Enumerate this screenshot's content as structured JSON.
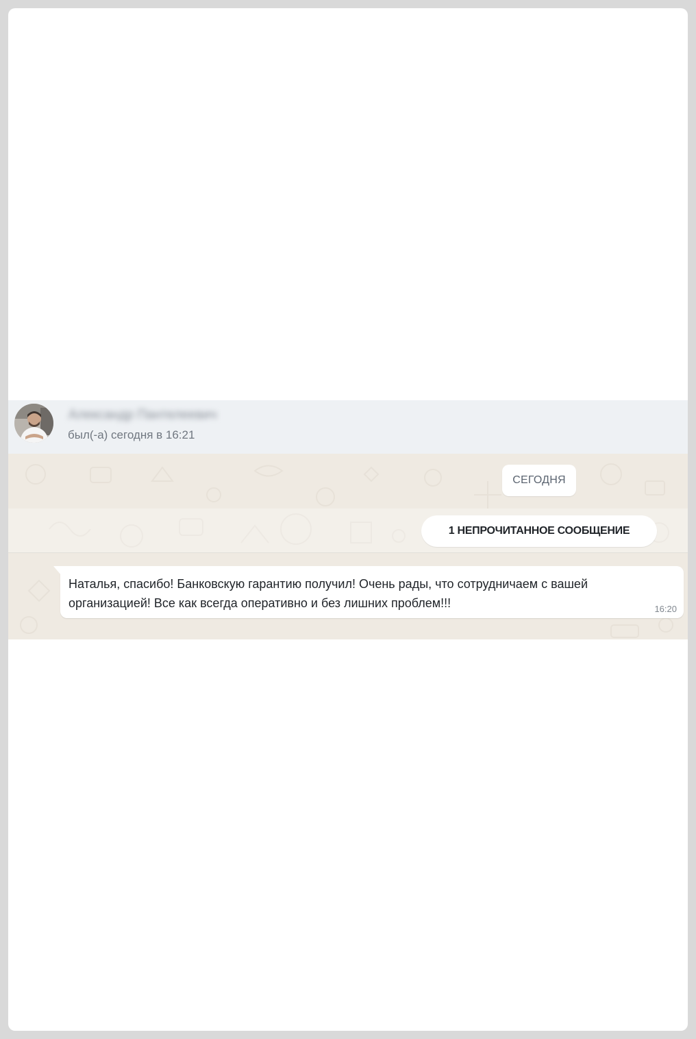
{
  "header": {
    "contact_name": "Александр Пантелеевич",
    "status": "был(-а) сегодня в 16:21"
  },
  "date_separator": {
    "label": "СЕГОДНЯ"
  },
  "unread_separator": {
    "label": "1 НЕПРОЧИТАННОЕ СООБЩЕНИЕ"
  },
  "messages": [
    {
      "text": "Наталья, спасибо! Банковскую гарантию получил! Очень рады, что сотрудничаем с вашей организацией! Все как всегда оперативно и без лишних проблем!!!",
      "time": "16:20",
      "direction": "incoming"
    }
  ],
  "colors": {
    "header_bg": "#eef1f4",
    "chat_bg": "#efeae2",
    "bubble_bg": "#ffffff"
  }
}
